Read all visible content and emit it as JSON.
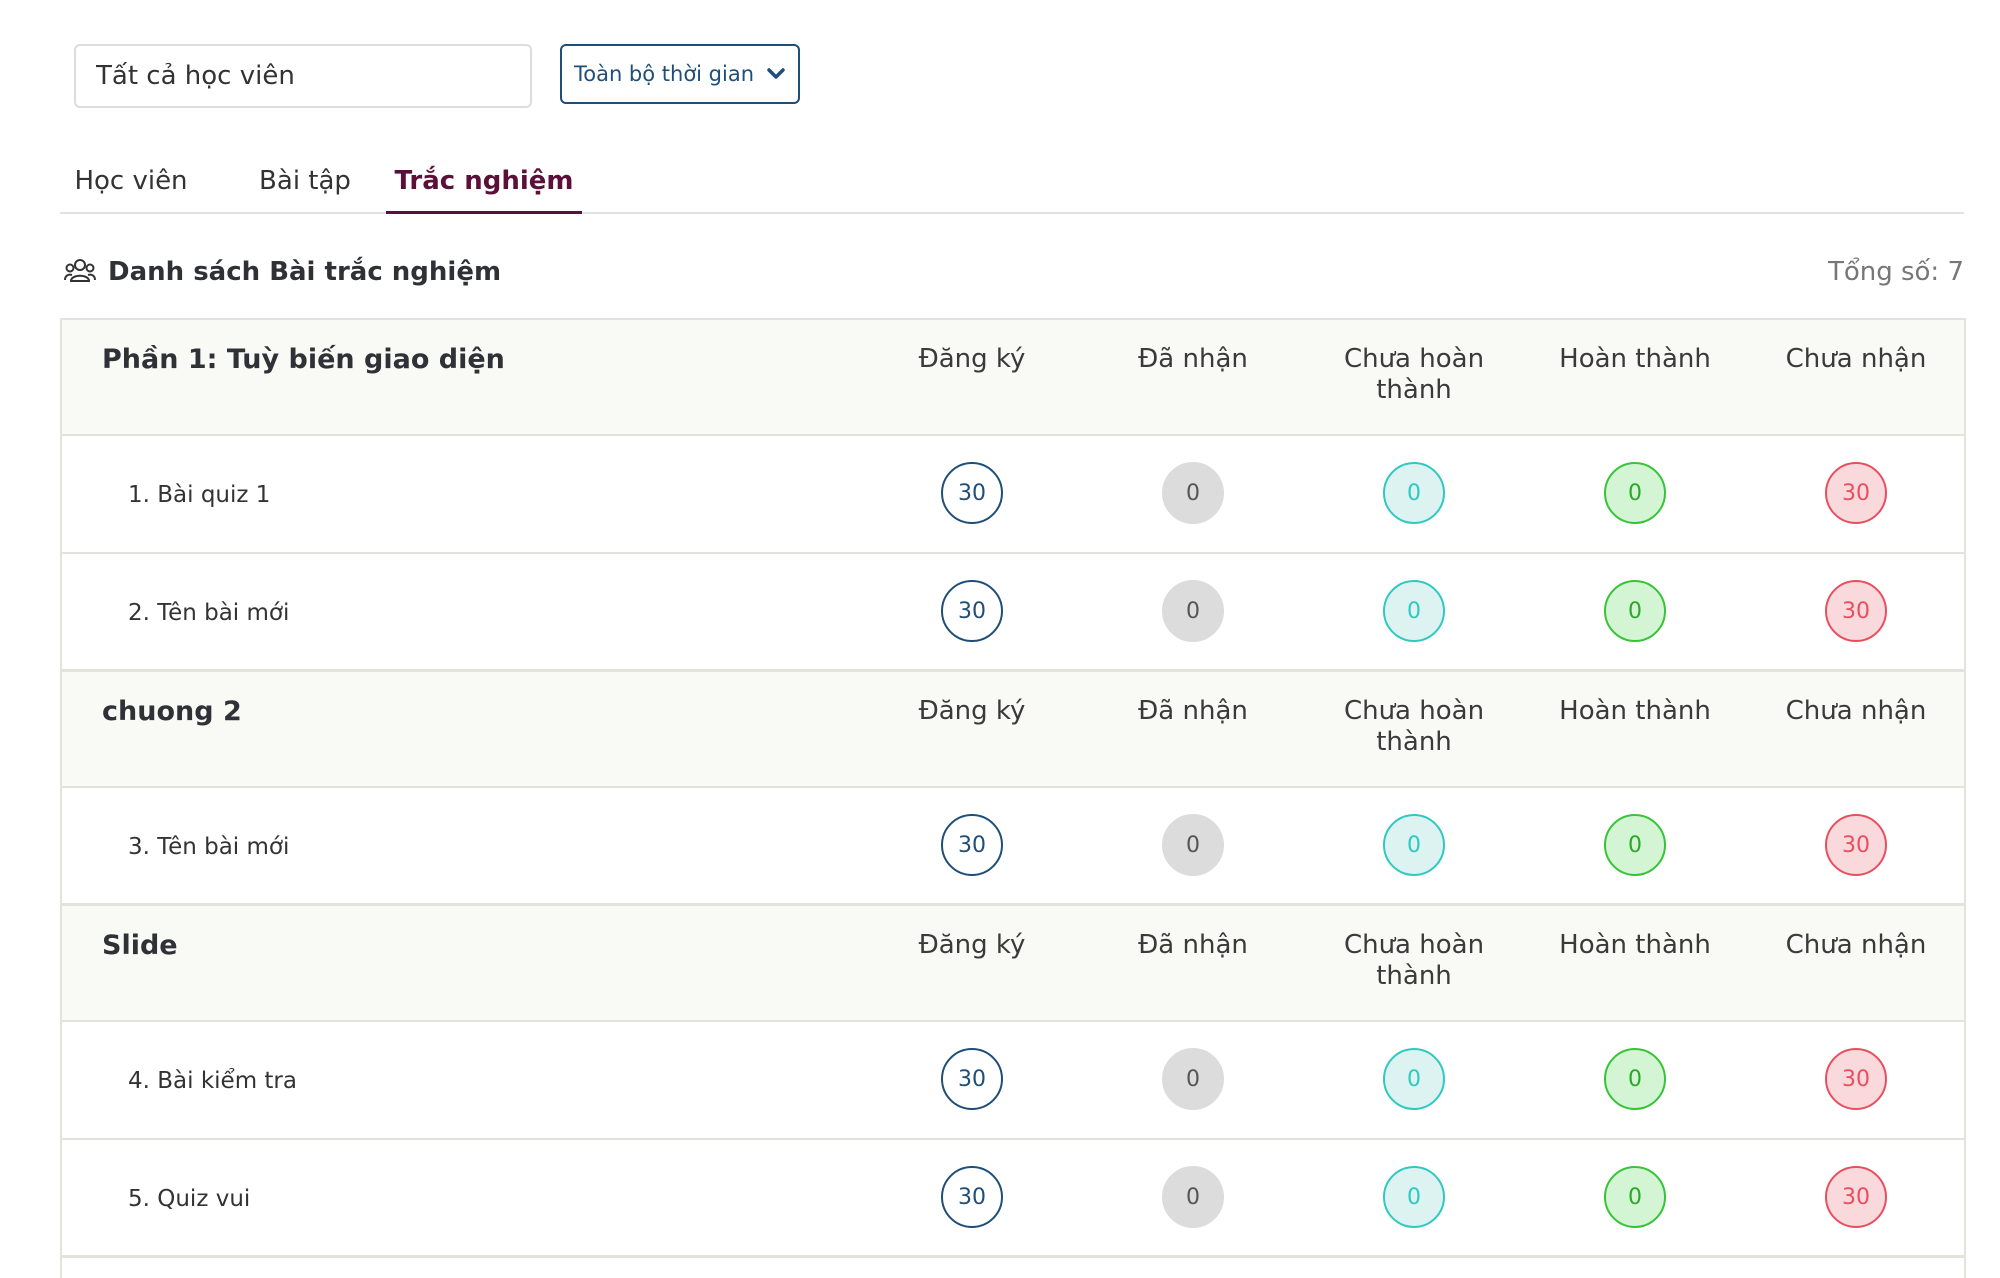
{
  "filters": {
    "student_filter_value": "Tất cả học viên",
    "time_range_label": "Toàn bộ thời gian"
  },
  "tabs": [
    {
      "label": "Học viên",
      "active": false
    },
    {
      "label": "Bài tập",
      "active": false
    },
    {
      "label": "Trắc nghiệm",
      "active": true
    }
  ],
  "list": {
    "title": "Danh sách Bài trắc nghiệm",
    "total_label": "Tổng số: 7"
  },
  "columns": {
    "registered": "Đăng ký",
    "received": "Đã nhận",
    "incomplete": "Chưa hoàn thành",
    "completed": "Hoàn thành",
    "not_received": "Chưa nhận"
  },
  "sections": [
    {
      "title": "Phần 1: Tuỳ biến giao diện",
      "items": [
        {
          "title": "1. Bài quiz 1",
          "registered": "30",
          "received": "0",
          "incomplete": "0",
          "completed": "0",
          "not_received": "30"
        },
        {
          "title": "2. Tên bài mới",
          "registered": "30",
          "received": "0",
          "incomplete": "0",
          "completed": "0",
          "not_received": "30"
        }
      ]
    },
    {
      "title": "chuong 2",
      "items": [
        {
          "title": "3. Tên bài mới",
          "registered": "30",
          "received": "0",
          "incomplete": "0",
          "completed": "0",
          "not_received": "30"
        }
      ]
    },
    {
      "title": "Slide",
      "items": [
        {
          "title": "4. Bài kiểm tra",
          "registered": "30",
          "received": "0",
          "incomplete": "0",
          "completed": "0",
          "not_received": "30"
        },
        {
          "title": "5. Quiz vui",
          "registered": "30",
          "received": "0",
          "incomplete": "0",
          "completed": "0",
          "not_received": "30"
        }
      ]
    }
  ],
  "colors": {
    "accent_tab": "#5a1038",
    "registered": "#1f4e79",
    "received": "#dcdcdc",
    "incomplete": "#2ec9c0",
    "completed": "#36c436",
    "not_received": "#e84f5e"
  },
  "icons": {
    "list_icon": "users-group-icon",
    "time_select_icon": "chevron-down-icon"
  }
}
